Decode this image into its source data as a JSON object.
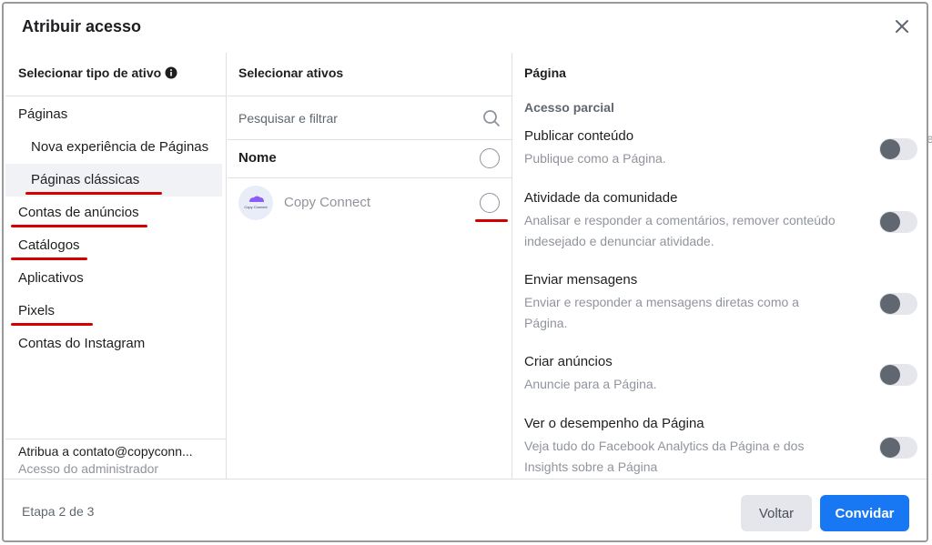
{
  "dialog": {
    "title": "Atribuir acesso",
    "close_icon": "close-icon"
  },
  "left": {
    "header": "Selecionar tipo de ativo",
    "info_icon": "info-icon",
    "items": [
      {
        "label": "Páginas"
      },
      {
        "label": "Nova experiência de Páginas"
      },
      {
        "label": "Páginas clássicas"
      },
      {
        "label": "Contas de anúncios"
      },
      {
        "label": "Catálogos"
      },
      {
        "label": "Aplicativos"
      },
      {
        "label": "Pixels"
      },
      {
        "label": "Contas do Instagram"
      }
    ],
    "footer": {
      "assign_to": "Atribua a contato@copyconn...",
      "role": "Acesso do administrador"
    }
  },
  "middle": {
    "header": "Selecionar ativos",
    "search": {
      "placeholder": "Pesquisar e filtrar",
      "value": ""
    },
    "name_header": "Nome",
    "assets": [
      {
        "name": "Copy Connect",
        "avatar_text": "Copy Connect"
      }
    ]
  },
  "right": {
    "header": "Página",
    "section": "Acesso parcial",
    "permissions": [
      {
        "title": "Publicar conteúdo",
        "desc": "Publique como a Página.",
        "enabled": false
      },
      {
        "title": "Atividade da comunidade",
        "desc": "Analisar e responder a comentários, remover conteúdo indesejado e denunciar atividade.",
        "enabled": false
      },
      {
        "title": "Enviar mensagens",
        "desc": "Enviar e responder a mensagens diretas como a Página.",
        "enabled": false
      },
      {
        "title": "Criar anúncios",
        "desc": "Anuncie para a Página.",
        "enabled": false
      },
      {
        "title": "Ver o desempenho da Página",
        "desc": "Veja tudo do Facebook Analytics da Página e dos Insights sobre a Página",
        "enabled": false
      }
    ]
  },
  "footer": {
    "step": "Etapa 2 de 3",
    "back_label": "Voltar",
    "invite_label": "Convidar"
  },
  "edge_text": "e",
  "colors": {
    "primary": "#1877f2",
    "annotation": "#d40000",
    "selected_bg": "#f0f2f5",
    "muted_text": "#90949c"
  }
}
